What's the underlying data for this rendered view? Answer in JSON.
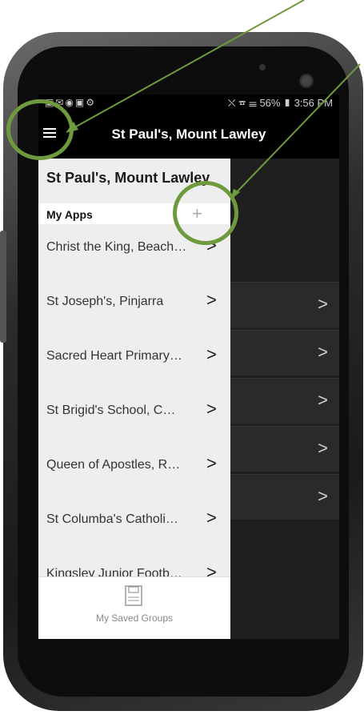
{
  "status": {
    "left_icons": "▣✉◉▣⚙",
    "right": "⛌ ☎ ☰ 56% ▮ 3:56 PM"
  },
  "appbar": {
    "title": "St Paul's, Mount Lawley"
  },
  "drawer": {
    "title": "St Paul's, Mount Lawley",
    "section_label": "My Apps",
    "add_label": "+",
    "items": [
      {
        "label": "Christ the King, Beach…"
      },
      {
        "label": "St Joseph's, Pinjarra"
      },
      {
        "label": "Sacred Heart Primary…"
      },
      {
        "label": "St Brigid's School, C…"
      },
      {
        "label": "Queen of Apostles, R…"
      },
      {
        "label": "St Columba's Catholi…"
      },
      {
        "label": "Kingsley Junior Footb…"
      }
    ],
    "chevron": ">",
    "footer_label": "My Saved Groups"
  },
  "background_chevrons": [
    ">",
    ">",
    ">",
    ">",
    ">"
  ],
  "colors": {
    "annotation": "#6e9a3d",
    "appbar": "#000000",
    "drawer": "#eeeeee"
  }
}
